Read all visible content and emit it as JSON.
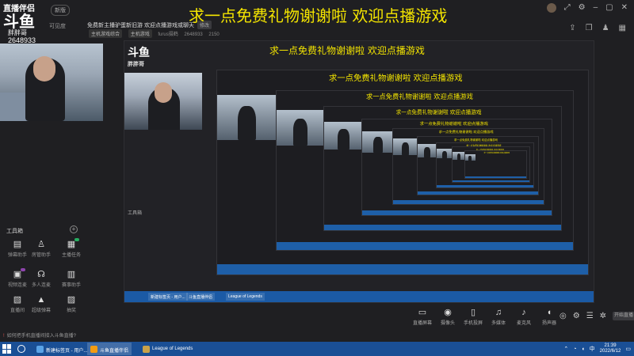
{
  "brand": {
    "top": "直播伴侣",
    "main": "斗鱼",
    "sub": "胖胖哥",
    "room_id": "2648933",
    "badge": "新版"
  },
  "side_label": "可见度",
  "banner": "求一点免费礼物谢谢啦 欢迎点播游戏",
  "stream": {
    "title": "免费新主播驴蛋新旧游 欢迎点播游戏或聊天",
    "title_tag": "修改",
    "category": "主机游戏综合",
    "sub_category": "主机游戏",
    "user": "furus摄鹤",
    "room": "2648933",
    "followers": "2150"
  },
  "top_icons": [
    "user-icon",
    "expand-icon",
    "settings-icon",
    "minimize-icon",
    "maximize-icon",
    "close-icon"
  ],
  "top_tools": [
    "share-icon",
    "copy-icon",
    "people-icon",
    "layout-icon"
  ],
  "tools_title": "工具箱",
  "tools": [
    {
      "name": "弹幕助手",
      "icon": "▤",
      "dot": ""
    },
    {
      "name": "房管助手",
      "icon": "♙",
      "dot": ""
    },
    {
      "name": "主播任务",
      "icon": "▦",
      "dot": "green"
    },
    {
      "name": "视频连麦",
      "icon": "▣",
      "dot": "purple"
    },
    {
      "name": "多人连麦",
      "icon": "☊",
      "dot": ""
    },
    {
      "name": "赛事助手",
      "icon": "▥",
      "dot": ""
    },
    {
      "name": "直播间",
      "icon": "▧",
      "dot": ""
    },
    {
      "name": "超级弹幕",
      "icon": "▲",
      "dot": ""
    },
    {
      "name": "抽奖",
      "icon": "▨",
      "dot": ""
    },
    {
      "name": "直播回放",
      "icon": "◐",
      "dot": ""
    },
    {
      "name": "活动中心",
      "icon": "✚",
      "dot": "red"
    },
    {
      "name": "更多",
      "icon": "◧",
      "dot": ""
    }
  ],
  "actions": [
    {
      "label": "直播屏幕",
      "icon": "▭"
    },
    {
      "label": "摄像头",
      "icon": "◉"
    },
    {
      "label": "手机投屏",
      "icon": "▯"
    },
    {
      "label": "多媒体",
      "icon": "♫"
    },
    {
      "label": "麦克风",
      "icon": "♪"
    },
    {
      "label": "扬声器",
      "icon": "◖"
    }
  ],
  "right_buttons": {
    "start": "开始直播"
  },
  "notice": {
    "prefix": "!",
    "text": "如何把手机直播间接入斗鱼直播?"
  },
  "taskbar": {
    "items": [
      {
        "label": "新建标签页 - 用户...",
        "color": "#5aa3e6",
        "active": false
      },
      {
        "label": "斗鱼直播伴侣",
        "color": "#f39c12",
        "active": true
      },
      {
        "label": "League of Legends",
        "color": "#c9a24a",
        "active": false
      }
    ],
    "time": "21:39",
    "date": "2022/6/12"
  },
  "preview": {
    "banner": "求一点免费礼物谢谢啦 欢迎点播游戏",
    "logo": "斗鱼",
    "logo_sub": "胖胖哥",
    "tools_title": "工具箱",
    "taskbar_items": [
      "新建标签页 - 用户...",
      "斗鱼直播伴侣",
      "League of Legends"
    ]
  }
}
